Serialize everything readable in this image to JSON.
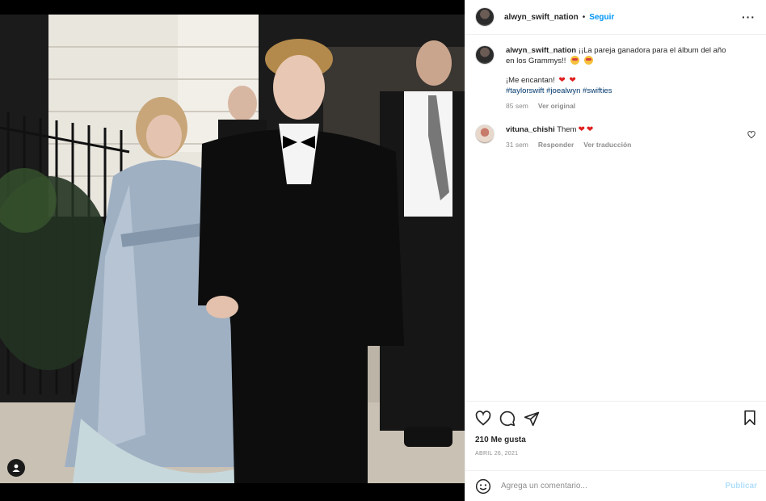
{
  "post": {
    "username": "alwyn_swift_nation",
    "follow_label": "Seguir",
    "separator": "•",
    "more_label": "···"
  },
  "caption": {
    "username": "alwyn_swift_nation",
    "text_line1": "¡¡La pareja ganadora para el álbum del año",
    "text_line2": "en los Grammys!!",
    "text_line3": "¡Me encantan!",
    "hashtags": "#taylorswift #joealwyn #swifties",
    "time": "85 sem",
    "translate_label": "Ver original"
  },
  "comments": [
    {
      "username": "vituna_chishi",
      "text": "Them",
      "time": "31 sem",
      "reply_label": "Responder",
      "translate_label": "Ver traducción"
    }
  ],
  "actions": {
    "likes": "210 Me gusta",
    "date": "ABRIL 26, 2021"
  },
  "add_comment": {
    "placeholder": "Agrega un comentario...",
    "publish_label": "Publicar"
  },
  "icons": [
    "more-options-icon",
    "heart-icon",
    "comment-icon",
    "share-icon",
    "bookmark-icon",
    "emoji-icon",
    "tag-user-icon"
  ],
  "colors": {
    "follow_blue": "#0095f6",
    "hashtag_blue": "#00376b",
    "publish_disabled": "#b2dffc",
    "heart_red": "#e02020"
  }
}
